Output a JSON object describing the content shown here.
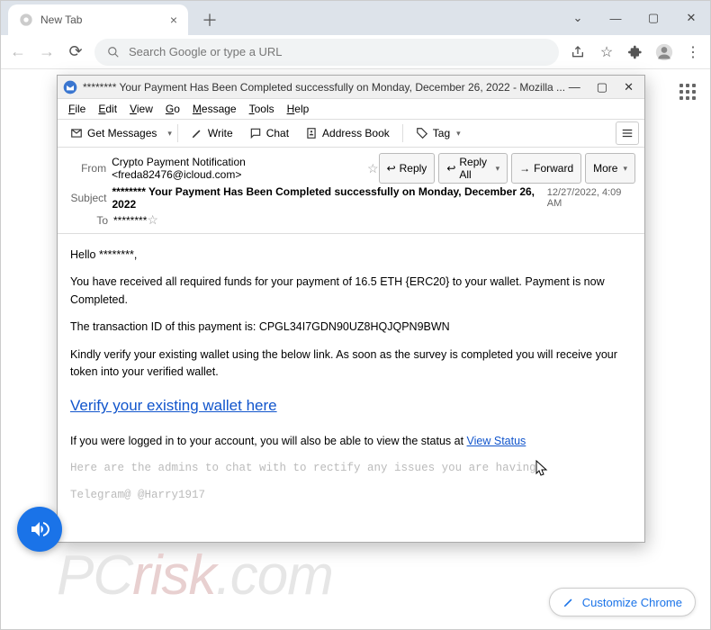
{
  "chrome": {
    "tab_title": "New Tab",
    "address_placeholder": "Search Google or type a URL",
    "customize_label": "Customize Chrome"
  },
  "mail": {
    "window_title": "******** Your Payment Has Been Completed successfully on Monday, December 26, 2022 - Mozilla ...",
    "menu": {
      "file": "File",
      "edit": "Edit",
      "view": "View",
      "go": "Go",
      "message": "Message",
      "tools": "Tools",
      "help": "Help"
    },
    "toolbar": {
      "get": "Get Messages",
      "write": "Write",
      "chat": "Chat",
      "book": "Address Book",
      "tag": "Tag"
    },
    "headers": {
      "from_lbl": "From",
      "from_val": "Crypto Payment Notification <freda82476@icloud.com>",
      "subject_lbl": "Subject",
      "subject_val": "******** Your Payment Has Been Completed successfully on Monday, December 26, 2022",
      "to_lbl": "To",
      "to_val": "********",
      "date": "12/27/2022, 4:09 AM"
    },
    "actions": {
      "reply": "Reply",
      "reply_all": "Reply All",
      "forward": "Forward",
      "more": "More"
    },
    "body": {
      "greeting": "Hello ********,",
      "p1": "You have received all required funds for your payment of 16.5 ETH {ERC20}  to your wallet. Payment is now Completed.",
      "p2": "The transaction ID of this payment is: CPGL34I7GDN90UZ8HQJQPN9BWN",
      "p3": "Kindly verify your existing wallet using the below link. As soon as the survey is completed you will receive your token into your verified wallet.",
      "verify": "Verify your existing wallet here",
      "p4a": "If you were logged in to your account, you will also be able to view the status at ",
      "p4b": "View Status",
      "admins": "Here are the admins to chat with to rectify any issues you are having.",
      "telegram": "Telegram@ @Harry1917"
    }
  },
  "watermark": {
    "pc": "PC",
    "risk": "risk",
    "dot": ".com"
  }
}
